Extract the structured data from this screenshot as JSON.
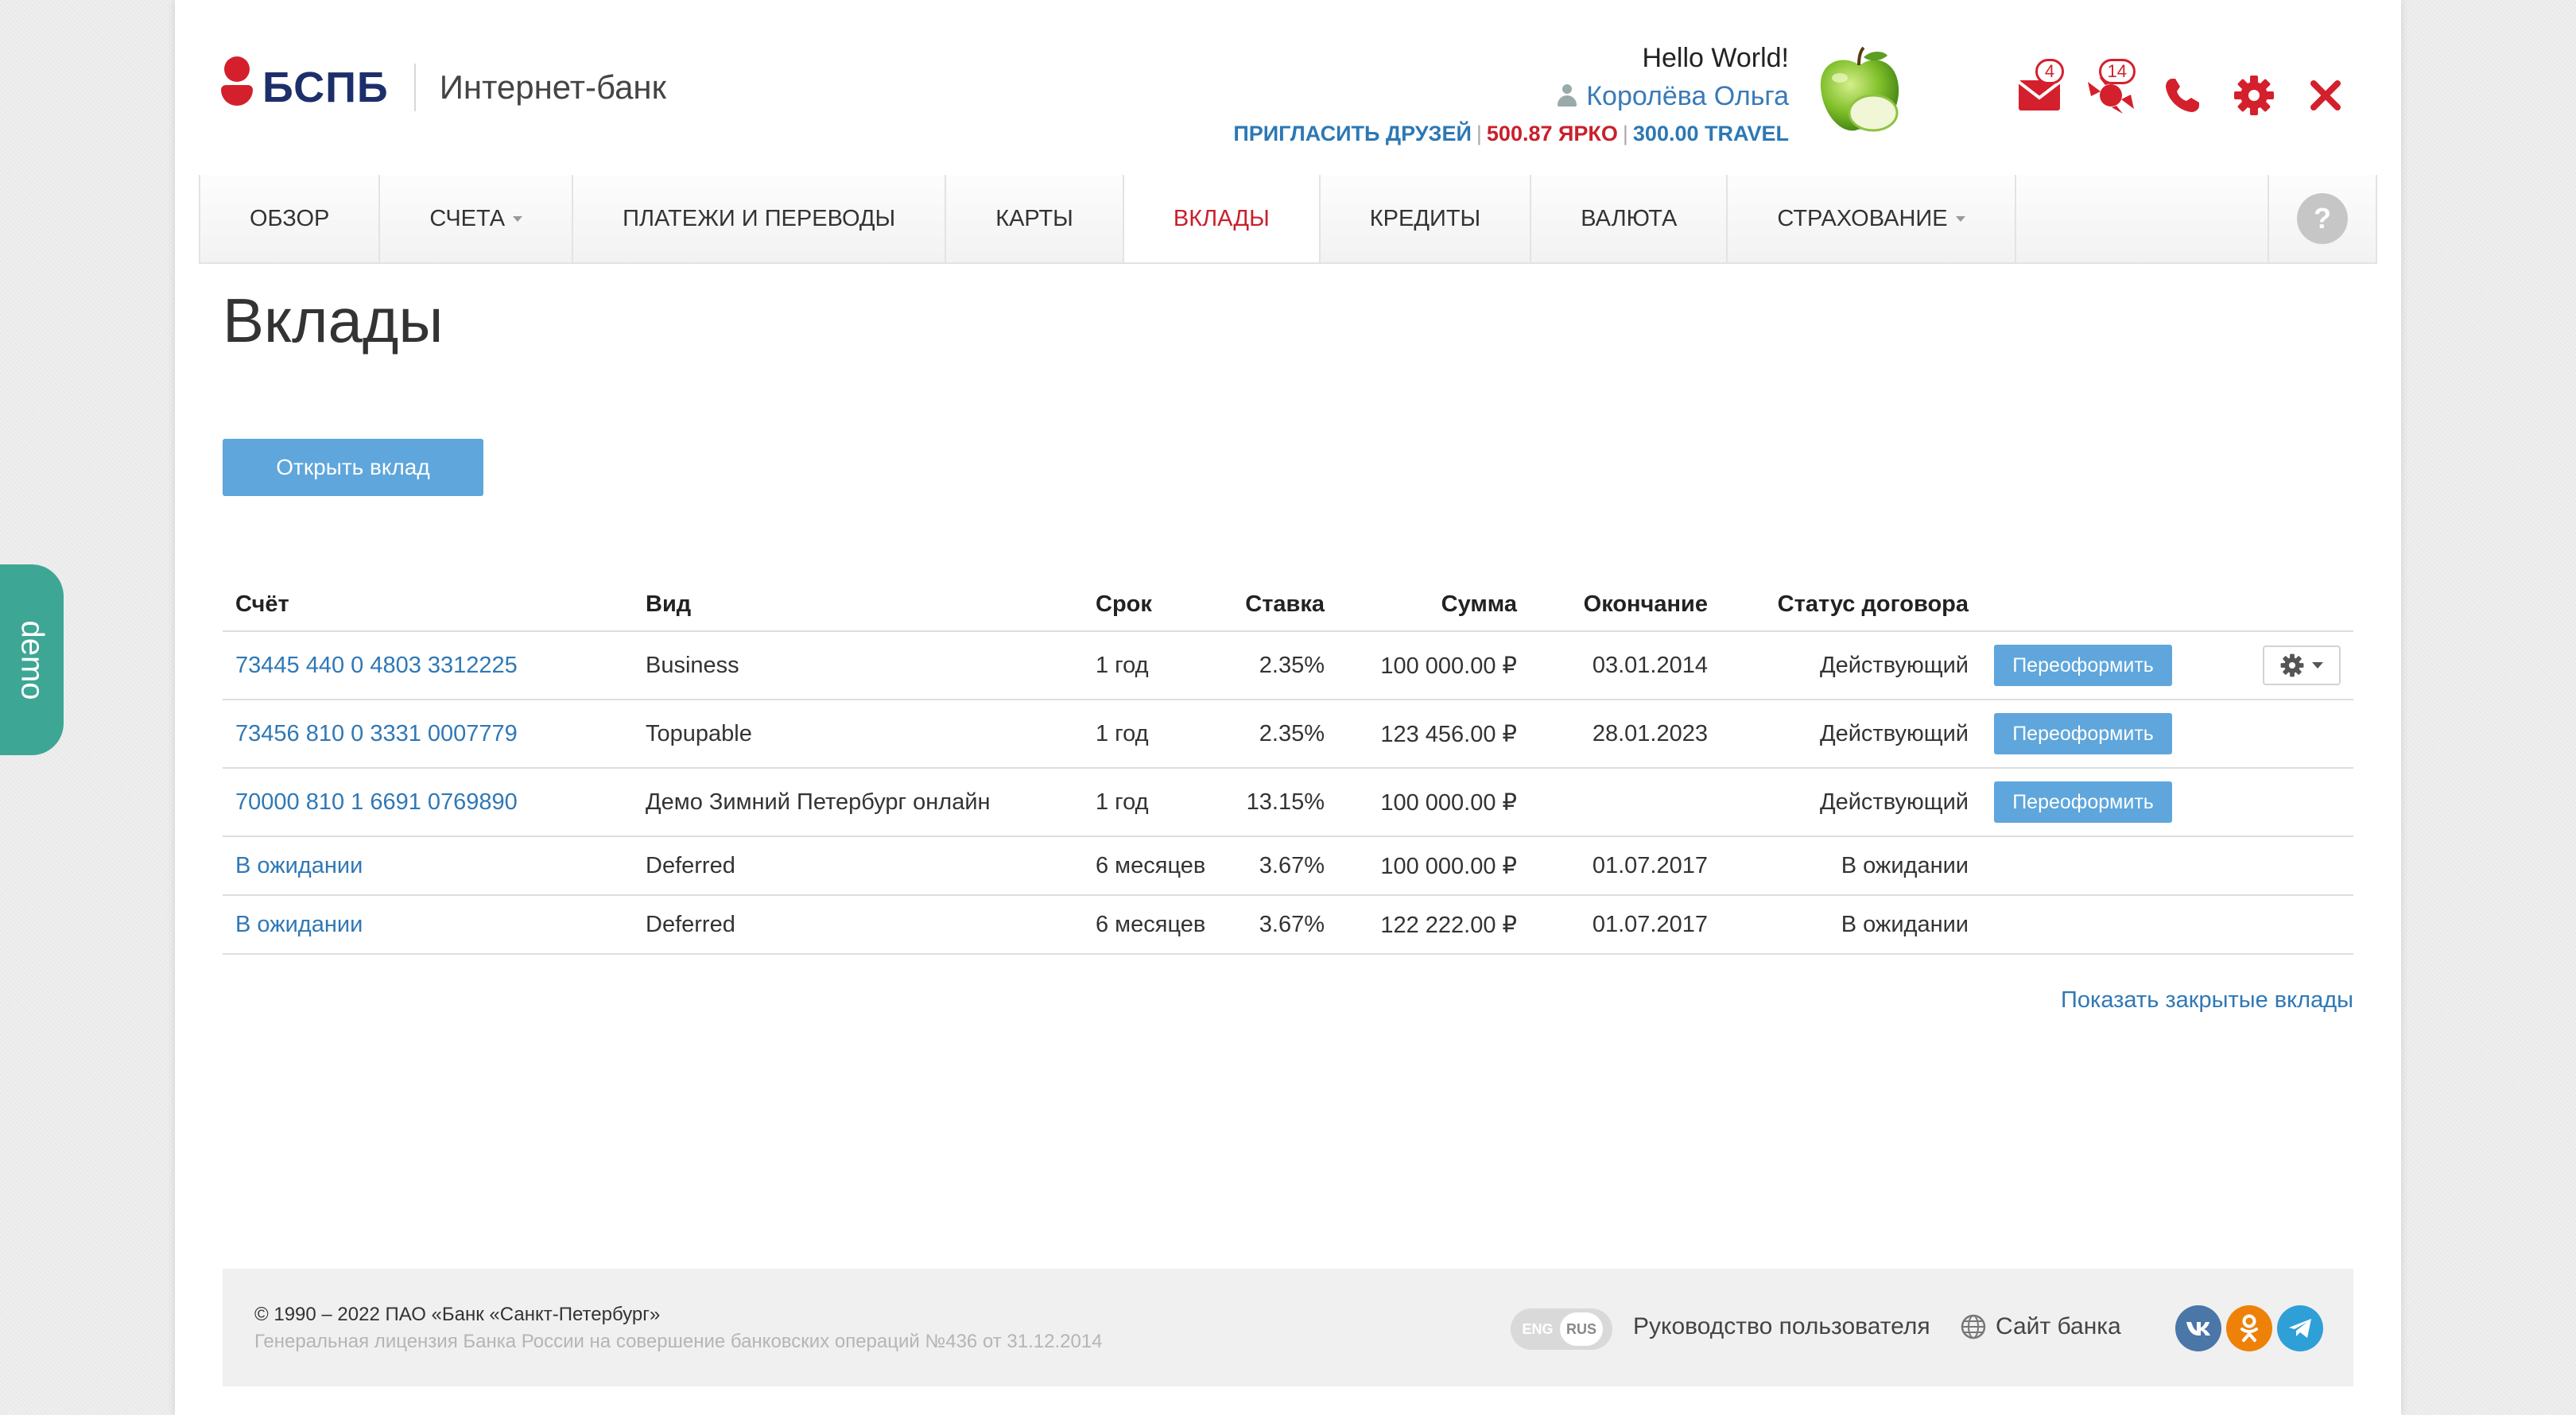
{
  "brand": {
    "logo": "БСПБ",
    "subtitle": "Интернет-банк",
    "accent": "#d4202c",
    "logo_color": "#1d2f6b"
  },
  "user": {
    "greeting": "Hello World!",
    "name": "Королёва Ольга",
    "invite": "ПРИГЛАСИТЬ ДРУЗЕЙ",
    "yarko": "500.87 ЯРКО",
    "travel": "300.00 TRAVEL"
  },
  "header_icons": [
    {
      "icon": "mail-icon",
      "badge": "4"
    },
    {
      "icon": "candy-icon",
      "badge": "14"
    },
    {
      "icon": "phone-icon"
    },
    {
      "icon": "gear-icon"
    },
    {
      "icon": "close-icon"
    }
  ],
  "nav": {
    "items": [
      {
        "label": "ОБЗОР",
        "dropdown": false,
        "active": false
      },
      {
        "label": "СЧЕТА",
        "dropdown": true,
        "active": false
      },
      {
        "label": "ПЛАТЕЖИ И ПЕРЕВОДЫ",
        "dropdown": false,
        "active": false
      },
      {
        "label": "КАРТЫ",
        "dropdown": false,
        "active": false
      },
      {
        "label": "ВКЛАДЫ",
        "dropdown": false,
        "active": true
      },
      {
        "label": "КРЕДИТЫ",
        "dropdown": false,
        "active": false
      },
      {
        "label": "ВАЛЮТА",
        "dropdown": false,
        "active": false
      },
      {
        "label": "СТРАХОВАНИЕ",
        "dropdown": true,
        "active": false
      }
    ],
    "help": "?"
  },
  "page": {
    "title": "Вклады",
    "open_button": "Открыть вклад",
    "show_closed": "Показать закрытые вклады"
  },
  "table": {
    "headers": [
      "Счёт",
      "Вид",
      "Срок",
      "Ставка",
      "Сумма",
      "Окончание",
      "Статус договора"
    ],
    "reissue_label": "Переоформить",
    "rows": [
      {
        "account": "73445 440 0 4803 3312225",
        "type": "Business",
        "term": "1 год",
        "rate": "2.35%",
        "amount": "100 000.00 ₽",
        "end": "03.01.2014",
        "status": "Действующий",
        "reissue": true,
        "settings": true
      },
      {
        "account": "73456 810 0 3331 0007779",
        "type": "Topupable",
        "term": "1 год",
        "rate": "2.35%",
        "amount": "123 456.00 ₽",
        "end": "28.01.2023",
        "status": "Действующий",
        "reissue": true,
        "settings": false
      },
      {
        "account": "70000 810 1 6691 0769890",
        "type": "Демо Зимний Петербург онлайн",
        "term": "1 год",
        "rate": "13.15%",
        "amount": "100 000.00 ₽",
        "end": "",
        "status": "Действующий",
        "reissue": true,
        "settings": false
      },
      {
        "account": "В ожидании",
        "type": "Deferred",
        "term": "6 месяцев",
        "rate": "3.67%",
        "amount": "100 000.00 ₽",
        "end": "01.07.2017",
        "status": "В ожидании",
        "reissue": false,
        "settings": false
      },
      {
        "account": "В ожидании",
        "type": "Deferred",
        "term": "6 месяцев",
        "rate": "3.67%",
        "amount": "122 222.00 ₽",
        "end": "01.07.2017",
        "status": "В ожидании",
        "reissue": false,
        "settings": false
      }
    ]
  },
  "footer": {
    "copyright": "© 1990 – 2022 ПАО «Банк «Санкт-Петербург»",
    "license": "Генеральная лицензия Банка России на совершение банковских операций №436 от 31.12.2014",
    "lang_eng": "ENG",
    "lang_rus": "RUS",
    "guide": "Руководство пользователя",
    "site": "Сайт банка",
    "socials": [
      {
        "icon": "vk-icon",
        "color": "#4a76a8",
        "glyph": "vk"
      },
      {
        "icon": "odnoklassniki-icon",
        "color": "#ee8208",
        "glyph": "ok"
      },
      {
        "icon": "telegram-icon",
        "color": "#2f9fd8",
        "glyph": "tg"
      }
    ]
  },
  "demo_tab": "demo"
}
